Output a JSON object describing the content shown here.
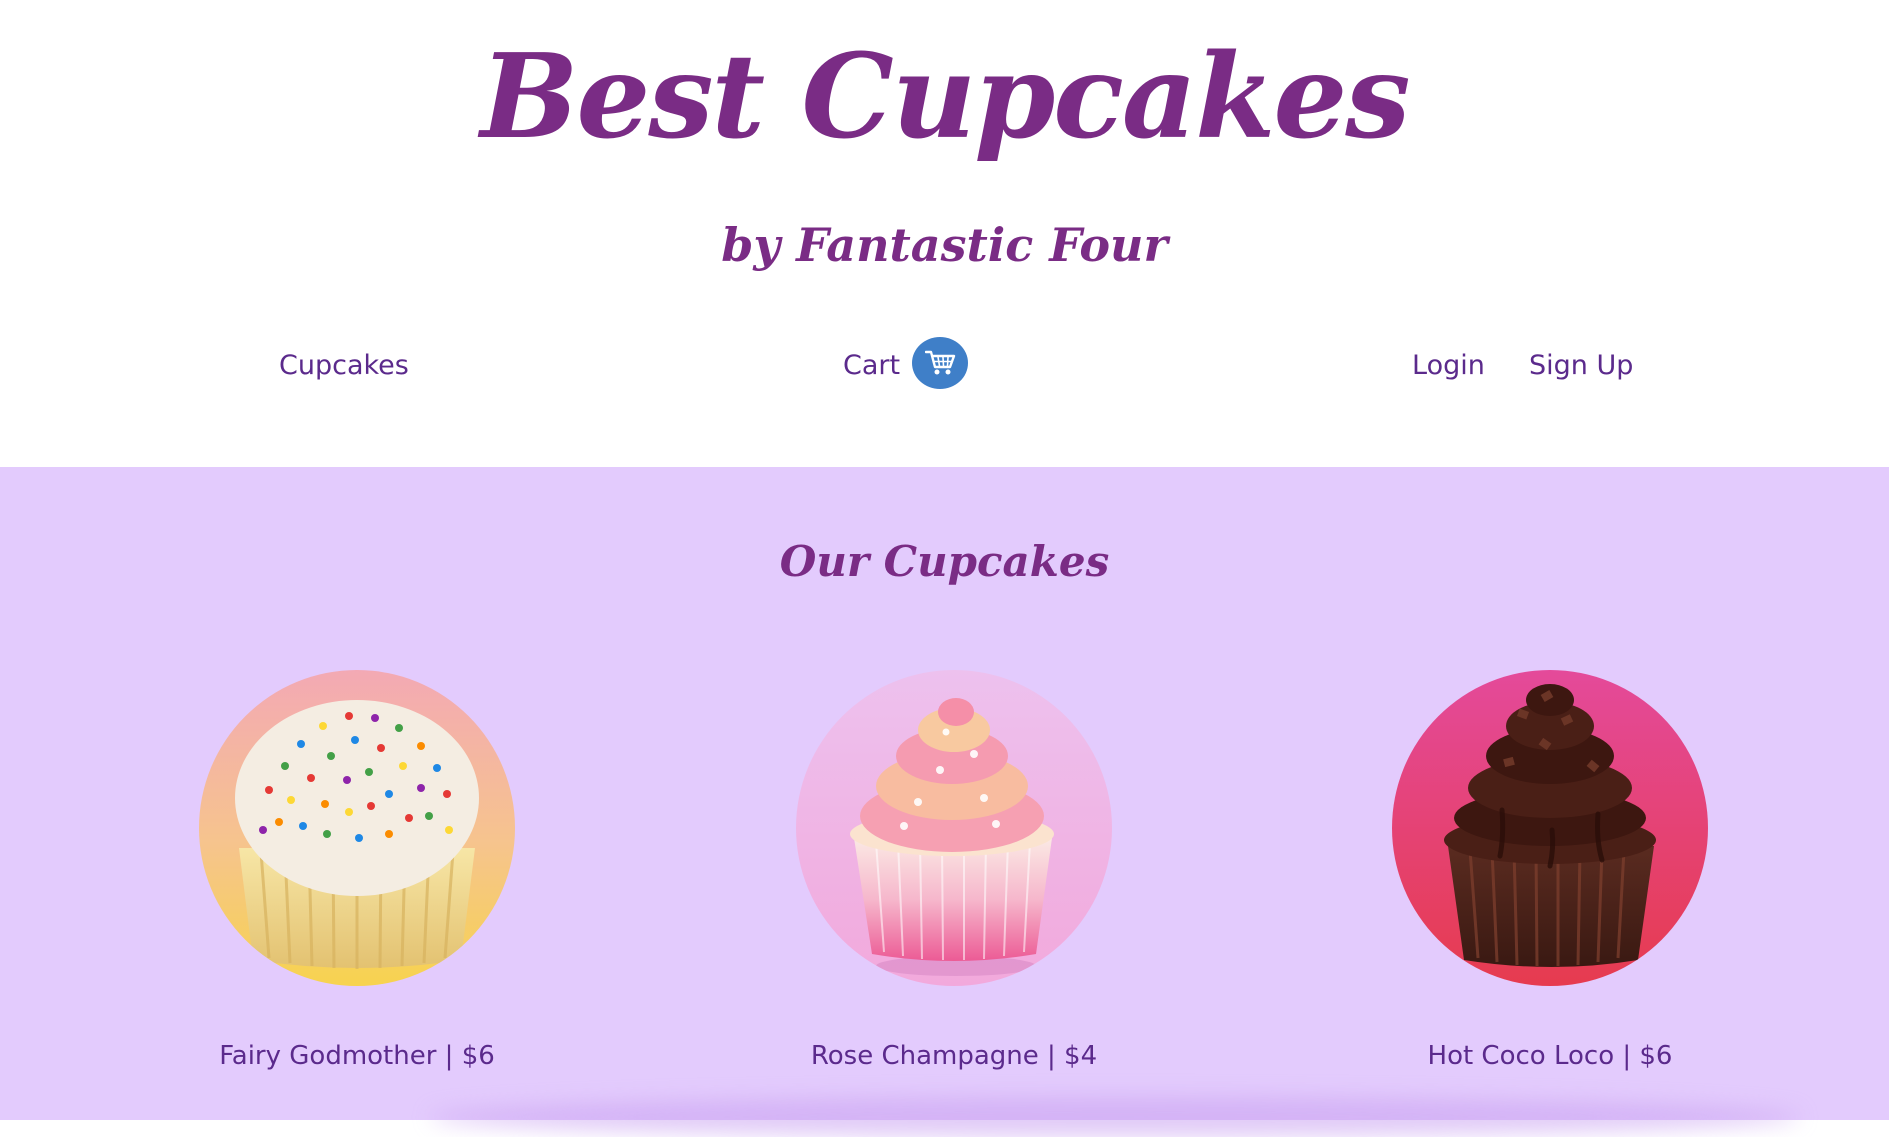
{
  "header": {
    "title": "Best Cupcakes",
    "subtitle": "by Fantastic Four"
  },
  "nav": {
    "cupcakes": "Cupcakes",
    "cart": "Cart",
    "login": "Login",
    "signup": "Sign Up"
  },
  "main": {
    "section_title": "Our Cupcakes",
    "products": [
      {
        "label": "Fairy Godmother | $6"
      },
      {
        "label": "Rose Champagne | $4"
      },
      {
        "label": "Hot Coco Loco | $6"
      }
    ]
  },
  "icons": {
    "cart": "shopping-cart-icon"
  },
  "colors": {
    "title": "#7a2c85",
    "nav_text": "#5b2a8c",
    "cart_badge": "#3f7fc8",
    "section_background": "#e3cbfd",
    "header_background": "#ffffff"
  }
}
